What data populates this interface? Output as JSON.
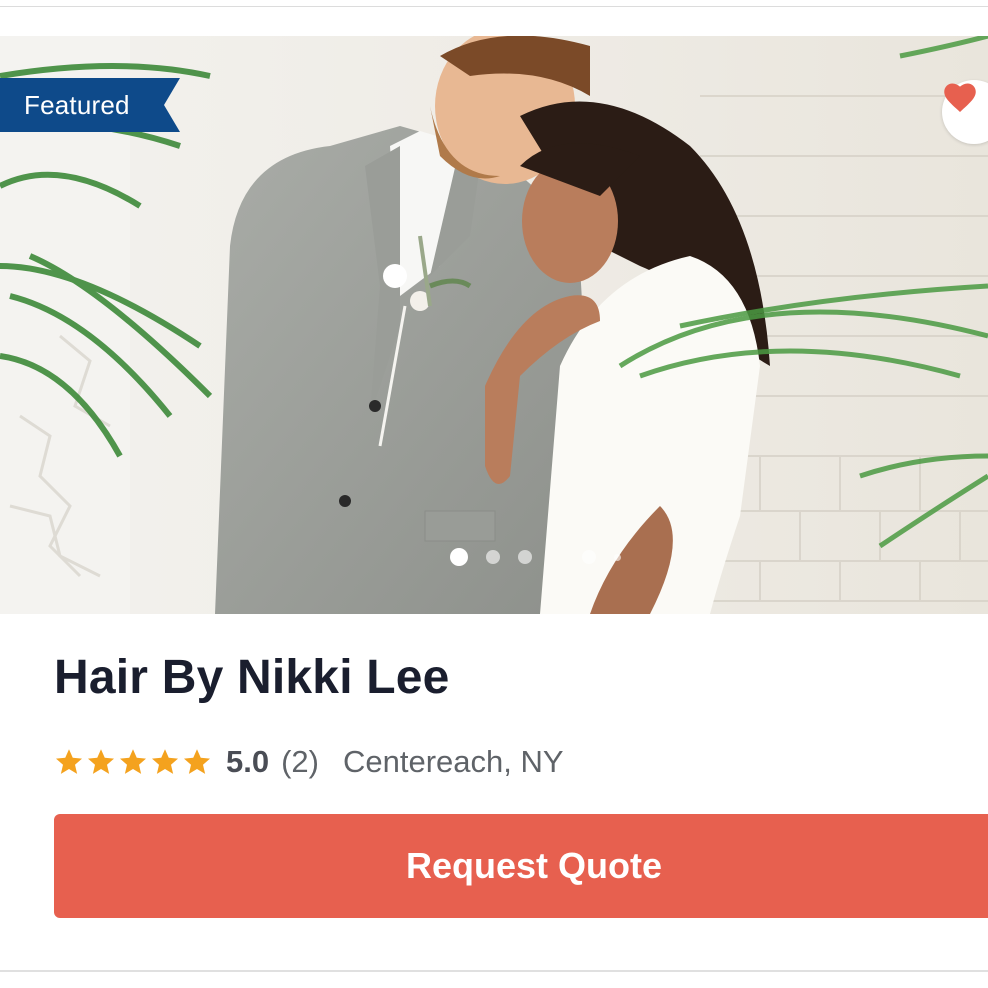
{
  "listing": {
    "badge": "Featured",
    "name": "Hair By Nikki Lee",
    "rating_value": "5.0",
    "review_count": "(2)",
    "location": "Centereach, NY",
    "stars": 5,
    "cta_label": "Request Quote",
    "photo_count": 5,
    "active_photo_index": 0
  },
  "colors": {
    "badge_background": "#0e4a8a",
    "star": "#f4a21e",
    "cta_background": "#e7604f",
    "heart": "#e7604f",
    "title": "#1a1e2e"
  },
  "icons": {
    "favorite": "heart-icon",
    "rating": "star-icon"
  }
}
